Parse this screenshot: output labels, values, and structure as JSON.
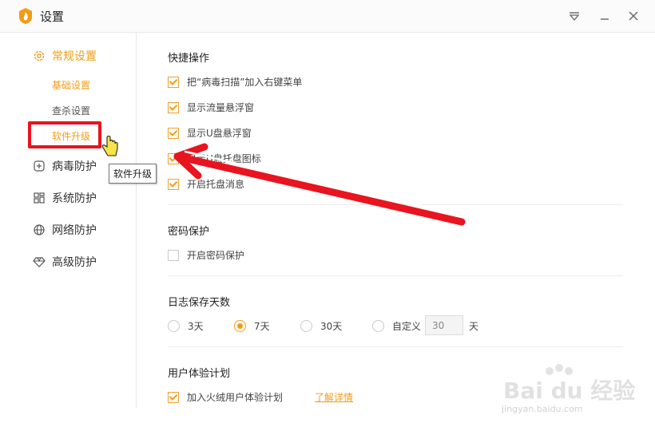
{
  "window": {
    "title": "设置"
  },
  "sidebar": {
    "general": "常规设置",
    "sub": [
      "基础设置",
      "查杀设置",
      "软件升级"
    ],
    "items": [
      "病毒防护",
      "系统防护",
      "网络防护",
      "高级防护"
    ]
  },
  "tooltip": "软件升级",
  "quick": {
    "title": "快捷操作",
    "options": [
      {
        "label": "把“病毒扫描”加入右键菜单",
        "checked": true
      },
      {
        "label": "显示流量悬浮窗",
        "checked": true
      },
      {
        "label": "显示U盘悬浮窗",
        "checked": true
      },
      {
        "label": "显示U盘托盘图标",
        "checked": true
      },
      {
        "label": "开启托盘消息",
        "checked": true
      }
    ]
  },
  "password": {
    "title": "密码保护",
    "option": "开启密码保护",
    "checked": false
  },
  "log": {
    "title": "日志保存天数",
    "options": [
      "3天",
      "7天",
      "30天",
      "自定义"
    ],
    "selected": "7天",
    "custom_value": "30",
    "unit": "天"
  },
  "experience": {
    "title": "用户体验计划",
    "option": "加入火绒用户体验计划",
    "checked": true,
    "link": "了解详情"
  },
  "watermark": {
    "brand": "Bai du 经验",
    "url": "jingyan.baidu.com"
  },
  "colors": {
    "accent": "#f39c12",
    "annotation": "#e8141f"
  }
}
